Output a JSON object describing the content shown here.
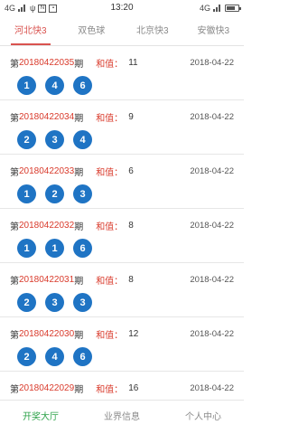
{
  "status": {
    "left_text": "4G",
    "time": "13:20",
    "right_text": "4G"
  },
  "tabs": [
    {
      "label": "河北快3",
      "active": true
    },
    {
      "label": "双色球",
      "active": false
    },
    {
      "label": "北京快3",
      "active": false
    },
    {
      "label": "安徽快3",
      "active": false
    }
  ],
  "list": {
    "prefix": "第",
    "suffix": "期",
    "sum_label": "和值：",
    "items": [
      {
        "issue": "20180422035",
        "sum": "11",
        "date": "2018-04-22",
        "balls": [
          "1",
          "4",
          "6"
        ]
      },
      {
        "issue": "20180422034",
        "sum": "9",
        "date": "2018-04-22",
        "balls": [
          "2",
          "3",
          "4"
        ]
      },
      {
        "issue": "20180422033",
        "sum": "6",
        "date": "2018-04-22",
        "balls": [
          "1",
          "2",
          "3"
        ]
      },
      {
        "issue": "20180422032",
        "sum": "8",
        "date": "2018-04-22",
        "balls": [
          "1",
          "1",
          "6"
        ]
      },
      {
        "issue": "20180422031",
        "sum": "8",
        "date": "2018-04-22",
        "balls": [
          "2",
          "3",
          "3"
        ]
      },
      {
        "issue": "20180422030",
        "sum": "12",
        "date": "2018-04-22",
        "balls": [
          "2",
          "4",
          "6"
        ]
      },
      {
        "issue": "20180422029",
        "sum": "16",
        "date": "2018-04-22",
        "balls": []
      }
    ]
  },
  "bottom_nav": [
    {
      "label": "开奖大厅",
      "active": true
    },
    {
      "label": "业界信息",
      "active": false
    },
    {
      "label": "个人中心",
      "active": false
    }
  ],
  "colors": {
    "accent_red": "#d93a2b",
    "ball_blue": "#1f74c4",
    "nav_green": "#2ea34a"
  }
}
